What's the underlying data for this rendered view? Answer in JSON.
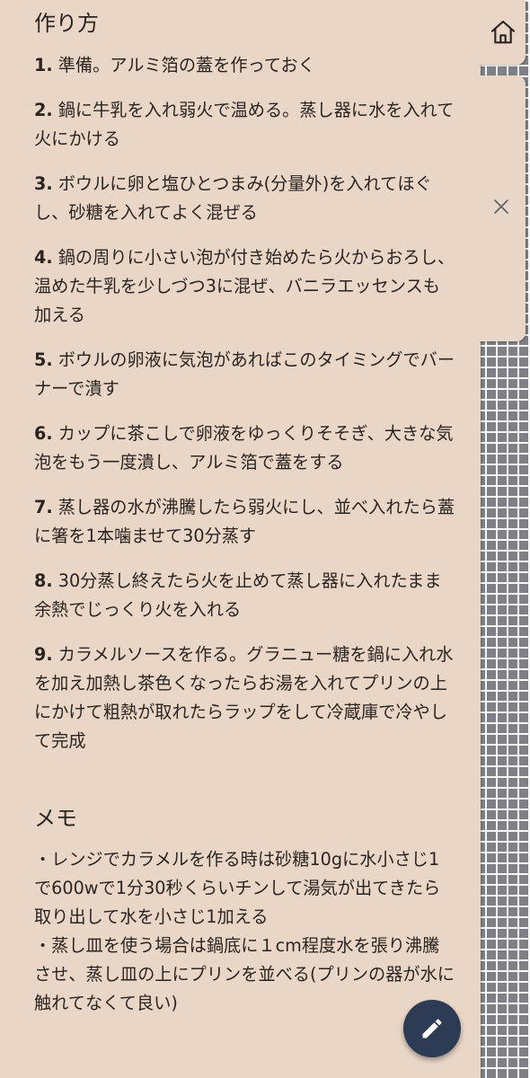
{
  "recipe": {
    "steps_title": "作り方",
    "steps": [
      {
        "num": "1.",
        "text": "準備。アルミ箔の蓋を作っておく"
      },
      {
        "num": "2.",
        "text": "鍋に牛乳を入れ弱火で温める。蒸し器に水を入れて火にかける"
      },
      {
        "num": "3.",
        "text": "ボウルに卵と塩ひとつまみ(分量外)を入れてほぐし、砂糖を入れてよく混ぜる"
      },
      {
        "num": "4.",
        "text": "鍋の周りに小さい泡が付き始めたら火からおろし、温めた牛乳を少しづつ3に混ぜ、バニラエッセンスも加える"
      },
      {
        "num": "5.",
        "text": "ボウルの卵液に気泡があればこのタイミングでバーナーで潰す"
      },
      {
        "num": "6.",
        "text": "カップに茶こしで卵液をゆっくりそそぎ、大きな気泡をもう一度潰し、アルミ箔で蓋をする"
      },
      {
        "num": "7.",
        "text": "蒸し器の水が沸騰したら弱火にし、並べ入れたら蓋に箸を1本噛ませて30分蒸す"
      },
      {
        "num": "8.",
        "text": "30分蒸し終えたら火を止めて蒸し器に入れたまま余熱でじっくり火を入れる"
      },
      {
        "num": "9.",
        "text": "カラメルソースを作る。グラニュー糖を鍋に入れ水を加え加熱し茶色くなったらお湯を入れてプリンの上にかけて粗熱が取れたらラップをして冷蔵庫で冷やして完成"
      }
    ],
    "memo_title": "メモ",
    "memo_lines": [
      "・レンジでカラメルを作る時は砂糖10gに水小さじ1で600wで1分30秒くらいチンして湯気が出てきたら取り出して水を小さじ1加える",
      "・蒸し皿を使う場合は鍋底に１cm程度水を張り沸騰させ、蒸し皿の上にプリンを並べる(プリンの器が水に触れてなくて良い)"
    ]
  },
  "icons": {
    "home": "home-icon",
    "close": "close-icon",
    "edit": "pencil-icon"
  },
  "colors": {
    "paper": "#e9d6c7",
    "text": "#2b2420",
    "fab": "#2e3b55"
  }
}
